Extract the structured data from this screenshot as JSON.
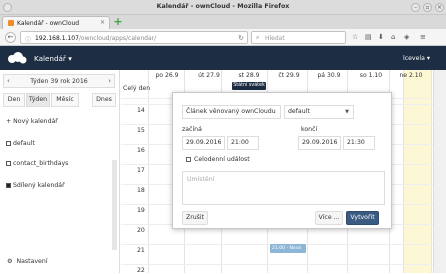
{
  "browser": {
    "window_title": "Kalendář - ownCloud - Mozilla Firefox",
    "tab_title": "Kalendář - ownCloud",
    "url_host": "192.168.1.107",
    "url_path": "/owncloud/apps/calendar/",
    "search_placeholder": "Hledat"
  },
  "header": {
    "app_name": "Kalendář",
    "app_arrow": "▾",
    "user": "lcevela ▾",
    "brand_color": "#1d2d44"
  },
  "sidebar": {
    "week_label": "Týden 39 rok 2016",
    "prev": "‹",
    "next": "›",
    "views": [
      "Den",
      "Týden",
      "Měsíc"
    ],
    "today": "Dnes",
    "new_calendar": "+ Nový kalendář",
    "calendars": [
      {
        "name": "default",
        "filled": false
      },
      {
        "name": "contact_birthdays",
        "filled": false
      },
      {
        "name": "Sdílený kalendář",
        "filled": true
      }
    ],
    "settings": "Nastavení"
  },
  "calendar": {
    "allday_label": "Celý den",
    "days": [
      "po 26.9",
      "út 27.9",
      "st 28.9",
      "čt 29.9",
      "pá 30.9",
      "so 1.10",
      "ne 2.10"
    ],
    "hours": [
      "14",
      "15",
      "16",
      "17",
      "18",
      "19",
      "20",
      "21",
      "22"
    ],
    "allday_event": "Státní svátek",
    "event_2130": "21:00 - Nová udál",
    "today_color": "#fcf8d5"
  },
  "popup": {
    "title_value": "Článek věnovaný ownCloudu",
    "calendar_select": "default",
    "start_label": "začíná",
    "end_label": "končí",
    "start_date": "29.09.2016",
    "start_time": "21:00",
    "end_date": "29.09.2016",
    "end_time": "21:30",
    "allday_checkbox": "Celodenní událost",
    "location_placeholder": "Umístění",
    "cancel": "Zrušit",
    "more": "Více ...",
    "create": "Vytvořit",
    "primary_color": "#3a5a80"
  }
}
